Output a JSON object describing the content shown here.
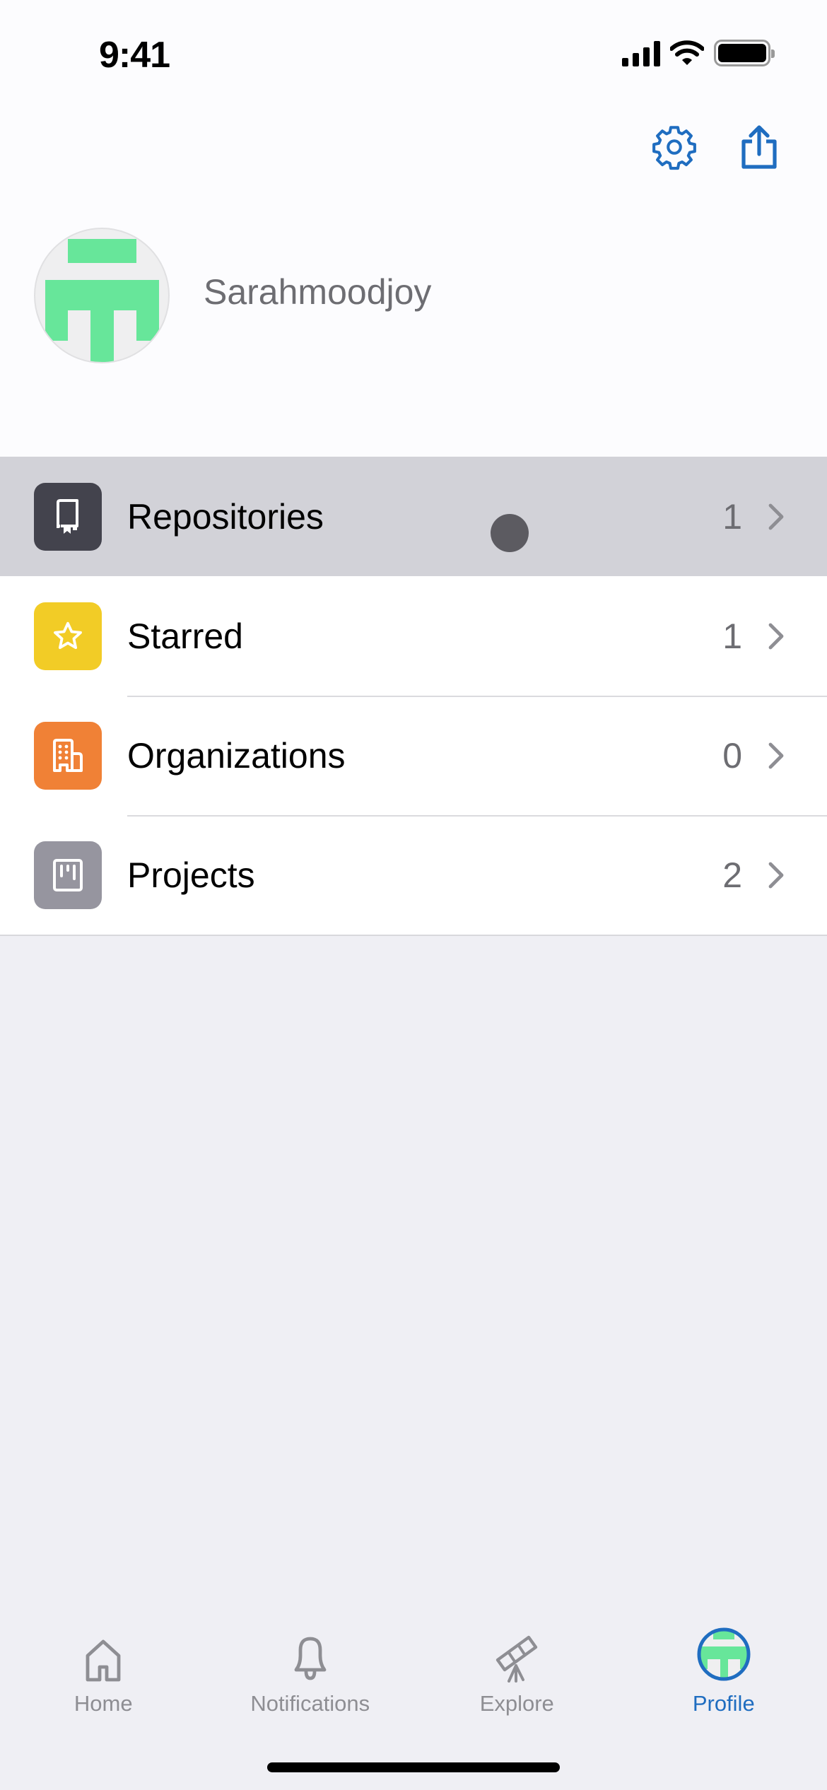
{
  "status_bar": {
    "time": "9:41",
    "icons": [
      "cellular-signal-icon",
      "wifi-icon",
      "battery-icon"
    ]
  },
  "header": {
    "buttons": [
      {
        "name": "settings",
        "icon": "gear-icon"
      },
      {
        "name": "share",
        "icon": "share-icon"
      }
    ]
  },
  "profile": {
    "username": "Sarahmoodjoy",
    "avatar_color": "#67e69a"
  },
  "menu": {
    "items": [
      {
        "label": "Repositories",
        "count": "1",
        "icon": "repo-icon",
        "color": "#43434d",
        "pressed": true
      },
      {
        "label": "Starred",
        "count": "1",
        "icon": "star-icon",
        "color": "#f2cc26"
      },
      {
        "label": "Organizations",
        "count": "0",
        "icon": "organization-icon",
        "color": "#f08136"
      },
      {
        "label": "Projects",
        "count": "2",
        "icon": "project-icon",
        "color": "#96959f"
      }
    ]
  },
  "tabbar": {
    "tabs": [
      {
        "label": "Home",
        "icon": "home-icon",
        "active": false
      },
      {
        "label": "Notifications",
        "icon": "bell-icon",
        "active": false
      },
      {
        "label": "Explore",
        "icon": "telescope-icon",
        "active": false
      },
      {
        "label": "Profile",
        "icon": "avatar-icon",
        "active": true
      }
    ],
    "active_color": "#1f6dc0",
    "inactive_color": "#8e8e93"
  }
}
